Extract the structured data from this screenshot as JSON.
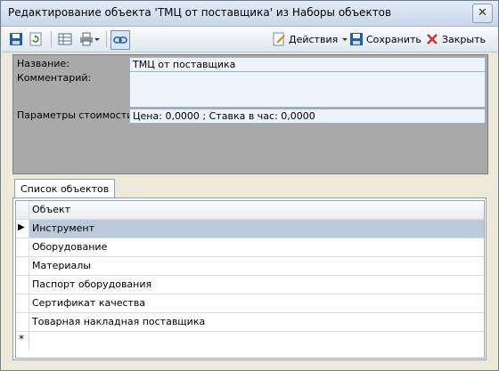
{
  "window": {
    "title": "Редактирование объекта 'ТМЦ от поставщика' из Наборы объектов",
    "close_glyph": "✕"
  },
  "toolbar": {
    "actions_label": "Действия",
    "save_label": "Сохранить",
    "close_label": "Закрыть"
  },
  "form": {
    "name_caption": "Название:",
    "name_value": "ТМЦ от поставщика",
    "comment_caption": "Комментарий:",
    "comment_value": "",
    "cost_caption": "Параметры стоимости:",
    "cost_value": "Цена: 0,0000 ; Ставка в час: 0,0000"
  },
  "tabs": [
    {
      "label": "Список объектов"
    }
  ],
  "grid": {
    "column_header": "Объект",
    "rows": [
      {
        "value": "Инструмент",
        "selected": true
      },
      {
        "value": "Оборудование"
      },
      {
        "value": "Материалы"
      },
      {
        "value": "Паспорт оборудования"
      },
      {
        "value": "Сертификат качества"
      },
      {
        "value": "Товарная накладная поставщика"
      }
    ],
    "current_row_marker": "▶",
    "new_row_marker": "*"
  },
  "colors": {
    "accent_blue": "#1f5fb3",
    "close_red": "#d22f2f",
    "selected_row": "#bccbdc",
    "form_bg": "#a9a9a9"
  }
}
